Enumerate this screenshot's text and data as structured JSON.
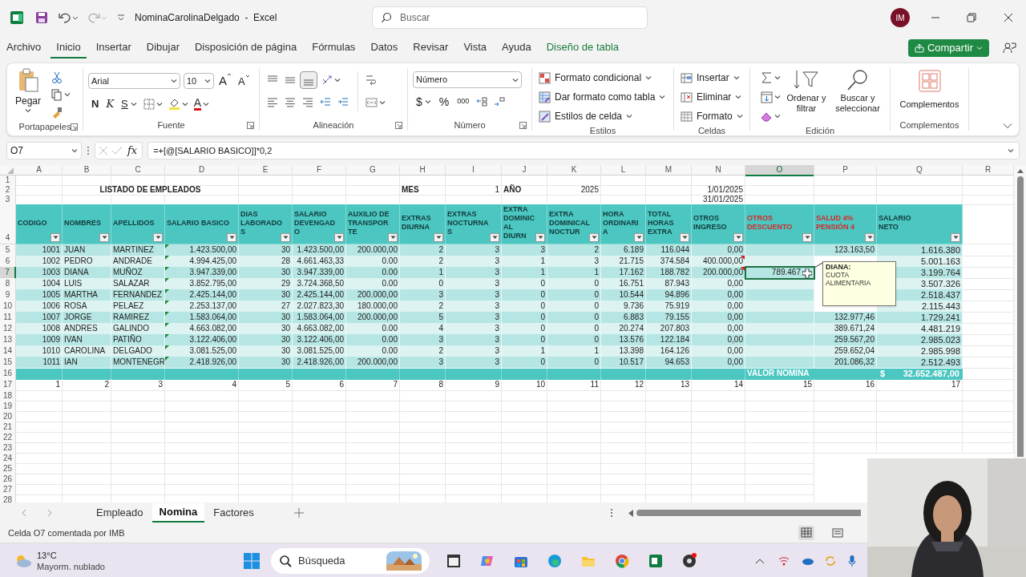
{
  "title_bar": {
    "title": "NominaCarolinaDelgado  -  Excel",
    "search_placeholder": "Buscar",
    "avatar": "IM"
  },
  "menu_tabs": [
    {
      "label": "Archivo",
      "selected": false,
      "kind": "normal"
    },
    {
      "label": "Inicio",
      "selected": true,
      "kind": "normal"
    },
    {
      "label": "Insertar",
      "selected": false,
      "kind": "normal"
    },
    {
      "label": "Dibujar",
      "selected": false,
      "kind": "normal"
    },
    {
      "label": "Disposición de página",
      "selected": false,
      "kind": "normal"
    },
    {
      "label": "Fórmulas",
      "selected": false,
      "kind": "normal"
    },
    {
      "label": "Datos",
      "selected": false,
      "kind": "normal"
    },
    {
      "label": "Revisar",
      "selected": false,
      "kind": "normal"
    },
    {
      "label": "Vista",
      "selected": false,
      "kind": "normal"
    },
    {
      "label": "Ayuda",
      "selected": false,
      "kind": "normal"
    },
    {
      "label": "Diseño de tabla",
      "selected": false,
      "kind": "contextual"
    }
  ],
  "share_button": "Compartir",
  "ribbon": {
    "clipboard": {
      "paste": "Pegar",
      "label": "Portapapeles"
    },
    "font": {
      "name": "Arial",
      "size": "10",
      "grow": "A",
      "shrink": "A",
      "bold": "N",
      "italic": "K",
      "underline": "S",
      "color_letter": "A",
      "label": "Fuente"
    },
    "alignment": {
      "label": "Alineación"
    },
    "number": {
      "format": "Número",
      "currency": "$",
      "percent": "%",
      "thousands": "000",
      "label": "Número"
    },
    "styles": {
      "items": [
        "Formato condicional",
        "Dar formato como tabla",
        "Estilos de celda"
      ],
      "label": "Estilos"
    },
    "cells": {
      "items": [
        "Insertar",
        "Eliminar",
        "Formato"
      ],
      "label": "Celdas"
    },
    "editing": {
      "sort": "Ordenar y filtrar",
      "find": "Buscar y seleccionar",
      "label": "Edición"
    },
    "addins": {
      "button": "Complementos",
      "label": "Complementos"
    }
  },
  "formula_bar": {
    "name_box": "O7",
    "fx": "fx",
    "formula": "=+[@[SALARIO BASICO]]*0,2"
  },
  "sheet": {
    "columns": [
      {
        "letter": "A",
        "selected": false
      },
      {
        "letter": "B",
        "selected": false
      },
      {
        "letter": "C",
        "selected": false
      },
      {
        "letter": "D",
        "selected": false
      },
      {
        "letter": "E",
        "selected": false
      },
      {
        "letter": "F",
        "selected": false
      },
      {
        "letter": "G",
        "selected": false
      },
      {
        "letter": "H",
        "selected": false
      },
      {
        "letter": "I",
        "selected": false
      },
      {
        "letter": "J",
        "selected": false
      },
      {
        "letter": "K",
        "selected": false
      },
      {
        "letter": "L",
        "selected": false
      },
      {
        "letter": "M",
        "selected": false
      },
      {
        "letter": "N",
        "selected": false
      },
      {
        "letter": "O",
        "selected": true
      },
      {
        "letter": "P",
        "selected": false
      },
      {
        "letter": "Q",
        "selected": false
      },
      {
        "letter": "R",
        "selected": false
      }
    ],
    "top_rows": [
      {
        "number": "1"
      },
      {
        "number": "2",
        "cells": [
          null,
          {
            "text": "LISTADO DE EMPLEADOS",
            "kind": "title"
          },
          null,
          null,
          null,
          null,
          null,
          {
            "text": "MES",
            "kind": "label"
          },
          {
            "text": "1",
            "kind": "value"
          },
          {
            "text": "AÑO",
            "kind": "label"
          },
          {
            "text": "2025",
            "kind": "value"
          },
          null,
          null,
          {
            "text": "1/01/2025",
            "kind": "value"
          }
        ]
      },
      {
        "number": "3",
        "cells": [
          null,
          null,
          null,
          null,
          null,
          null,
          null,
          null,
          null,
          null,
          null,
          null,
          null,
          {
            "text": "31/01/2025",
            "kind": "value"
          }
        ]
      }
    ],
    "header_row": {
      "number": "4",
      "headings": [
        {
          "lines": [
            "CODIGO"
          ],
          "kind": "normal"
        },
        {
          "lines": [
            "NOMBRES"
          ],
          "kind": "normal"
        },
        {
          "lines": [
            "APELLIDOS"
          ],
          "kind": "normal"
        },
        {
          "lines": [
            "SALARIO BASICO"
          ],
          "kind": "normal"
        },
        {
          "lines": [
            "DIAS",
            "LABORADO",
            "S"
          ],
          "kind": "normal"
        },
        {
          "lines": [
            "SALARIO",
            "DEVENGAD",
            "O"
          ],
          "kind": "normal"
        },
        {
          "lines": [
            "AUXILIO DE",
            "TRANSPOR",
            "TE"
          ],
          "kind": "normal"
        },
        {
          "lines": [
            "EXTRAS",
            "DIURNA"
          ],
          "kind": "normal"
        },
        {
          "lines": [
            "EXTRAS",
            "NOCTURNA",
            "S"
          ],
          "kind": "normal"
        },
        {
          "lines": [
            "EXTRA",
            "DOMINIC",
            "AL",
            "DIURN"
          ],
          "kind": "normal"
        },
        {
          "lines": [
            "EXTRA",
            "DOMINICAL",
            "NOCTUR"
          ],
          "kind": "normal"
        },
        {
          "lines": [
            "HORA",
            "ORDINARI",
            "A"
          ],
          "kind": "normal"
        },
        {
          "lines": [
            "TOTAL",
            "HORAS",
            "EXTRA"
          ],
          "kind": "normal"
        },
        {
          "lines": [
            "OTROS",
            "INGRESO"
          ],
          "kind": "normal"
        },
        {
          "lines": [
            "OTROS",
            "DESCUENTO"
          ],
          "kind": "deduction"
        },
        {
          "lines": [
            "SALUD 4%",
            "PENSIÓN 4"
          ],
          "kind": "deduction"
        },
        {
          "lines": [
            "SALARIO",
            "NETO"
          ],
          "kind": "normal"
        }
      ]
    },
    "rows": [
      {
        "number": "5",
        "selected": false,
        "error_mark": true,
        "comment_mark": false,
        "cells": [
          "1001",
          "JUAN",
          "MARTINEZ",
          "1.423.500,00",
          "30",
          "1.423.500,00",
          "200.000,00",
          "2",
          "3",
          "3",
          "2",
          "6.189",
          "116.044",
          "0,00",
          null,
          "123.163,50",
          "1.616.380"
        ]
      },
      {
        "number": "6",
        "selected": false,
        "error_mark": true,
        "comment_mark": true,
        "cells": [
          "1002",
          "PEDRO",
          "ANDRADE",
          "4.994.425,00",
          "28",
          "4.661.463,33",
          "0.00",
          "2",
          "3",
          "1",
          "3",
          "21.715",
          "374.584",
          "400.000,00",
          null,
          null,
          "5.001.163"
        ]
      },
      {
        "number": "7",
        "selected": true,
        "error_mark": true,
        "comment_mark": true,
        "cells": [
          "1003",
          "DIANA",
          "MUÑOZ",
          "3.947.339,00",
          "30",
          "3.947.339,00",
          "0.00",
          "1",
          "3",
          "1",
          "1",
          "17.162",
          "188.782",
          "200.000,00",
          "789.467",
          null,
          "3.199.764"
        ]
      },
      {
        "number": "8",
        "selected": false,
        "error_mark": true,
        "comment_mark": false,
        "cells": [
          "1004",
          "LUIS",
          "SALAZAR",
          "3.852.795,00",
          "29",
          "3.724.368,50",
          "0.00",
          "0",
          "3",
          "0",
          "0",
          "16.751",
          "87.943",
          "0,00",
          null,
          null,
          "3.507.326"
        ]
      },
      {
        "number": "9",
        "selected": false,
        "error_mark": true,
        "comment_mark": false,
        "cells": [
          "1005",
          "MARTHA",
          "FERNANDEZ",
          "2.425.144,00",
          "30",
          "2.425.144,00",
          "200.000,00",
          "3",
          "3",
          "0",
          "0",
          "10.544",
          "94.896",
          "0,00",
          null,
          null,
          "2.518.437"
        ]
      },
      {
        "number": "10",
        "selected": false,
        "error_mark": true,
        "comment_mark": false,
        "cells": [
          "1006",
          "ROSA",
          "PELAEZ",
          "2.253.137,00",
          "27",
          "2.027.823,30",
          "180.000,00",
          "2",
          "3",
          "0",
          "0",
          "9.736",
          "75.919",
          "0,00",
          null,
          null,
          "2.115.443"
        ]
      },
      {
        "number": "11",
        "selected": false,
        "error_mark": true,
        "comment_mark": false,
        "cells": [
          "1007",
          "JORGE",
          "RAMIREZ",
          "1.583.064,00",
          "30",
          "1.583.064,00",
          "200.000,00",
          "5",
          "3",
          "0",
          "0",
          "6.883",
          "79.155",
          "0,00",
          null,
          "132.977,46",
          "1.729.241"
        ]
      },
      {
        "number": "12",
        "selected": false,
        "error_mark": true,
        "comment_mark": false,
        "cells": [
          "1008",
          "ANDRES",
          "GALINDO",
          "4.663.082,00",
          "30",
          "4.663.082,00",
          "0.00",
          "4",
          "3",
          "0",
          "0",
          "20.274",
          "207.803",
          "0,00",
          null,
          "389.671,24",
          "4.481.219"
        ]
      },
      {
        "number": "13",
        "selected": false,
        "error_mark": true,
        "comment_mark": false,
        "cells": [
          "1009",
          "IVAN",
          "PATIÑO",
          "3.122.406,00",
          "30",
          "3.122.406,00",
          "0.00",
          "3",
          "3",
          "0",
          "0",
          "13.576",
          "122.184",
          "0,00",
          null,
          "259.567,20",
          "2.985.023"
        ]
      },
      {
        "number": "14",
        "selected": false,
        "error_mark": true,
        "comment_mark": false,
        "cells": [
          "1010",
          "CAROLINA",
          "DELGADO",
          "3.081.525,00",
          "30",
          "3.081.525,00",
          "0.00",
          "2",
          "3",
          "1",
          "1",
          "13.398",
          "164.126",
          "0,00",
          null,
          "259.652,04",
          "2.985.998"
        ]
      },
      {
        "number": "15",
        "selected": false,
        "error_mark": true,
        "comment_mark": false,
        "cells": [
          "1011",
          "IAN",
          "MONTENEGR",
          "2.418.926,00",
          "30",
          "2.418.926,00",
          "200.000,00",
          "3",
          "3",
          "0",
          "0",
          "10.517",
          "94.653",
          "0,00",
          null,
          "201.086,32",
          "2.512.493"
        ]
      }
    ],
    "total_row": {
      "number": "16",
      "label": "VALOR NOMINA",
      "currency": "$",
      "value": "32.652.487,00"
    },
    "index_row": {
      "number": "17",
      "cells": [
        "1",
        "2",
        "3",
        "4",
        "5",
        "6",
        "7",
        "8",
        "9",
        "10",
        "11",
        "12",
        "13",
        "14",
        "15",
        "16",
        "17"
      ]
    },
    "empty_rows": [
      "18",
      "19",
      "20",
      "21",
      "22",
      "23",
      "24",
      "25",
      "26",
      "27",
      "28"
    ],
    "comment": {
      "author": "DIANA:",
      "text": "CUOTA ALIMENTARIA"
    }
  },
  "sheet_tabs": [
    {
      "label": "Empleado",
      "selected": false
    },
    {
      "label": "Nomina",
      "selected": true
    },
    {
      "label": "Factores",
      "selected": false
    }
  ],
  "status_bar": {
    "text": "Celda O7 comentada por IMB"
  },
  "taskbar": {
    "temperature": "13°C",
    "condition": "Mayorm. nublado",
    "search_placeholder": "Búsqueda"
  }
}
